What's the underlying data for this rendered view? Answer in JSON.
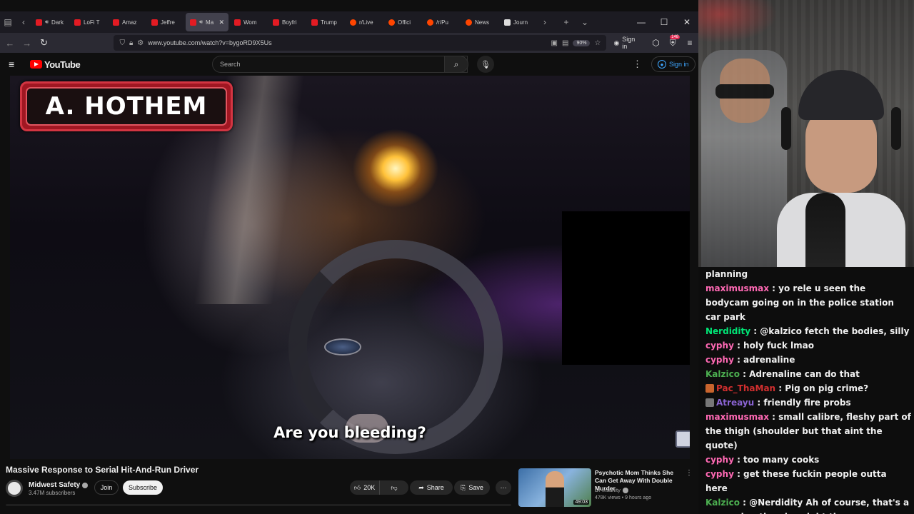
{
  "browser": {
    "tabs": [
      {
        "label": "Dark S",
        "favicon": "youtube",
        "audio": true
      },
      {
        "label": "LoFi T",
        "favicon": "youtube"
      },
      {
        "label": "Amaz",
        "favicon": "youtube"
      },
      {
        "label": "Jeffre",
        "favicon": "youtube"
      },
      {
        "label": "Ma",
        "favicon": "youtube",
        "audio": true,
        "active": true
      },
      {
        "label": "Wom",
        "favicon": "youtube"
      },
      {
        "label": "Boyfri",
        "favicon": "youtube"
      },
      {
        "label": "Trump",
        "favicon": "youtube"
      },
      {
        "label": "r/Live",
        "favicon": "reddit"
      },
      {
        "label": "Offici",
        "favicon": "reddit"
      },
      {
        "label": "/r/Pu",
        "favicon": "reddit"
      },
      {
        "label": "News",
        "favicon": "reddit"
      },
      {
        "label": "Journ",
        "favicon": "journal"
      }
    ],
    "url": "www.youtube.com/watch?v=bygoRD9X5Us",
    "zoom": "90%",
    "sign_in": "Sign in",
    "extension_badge": "148"
  },
  "youtube": {
    "logo_text": "YouTube",
    "search_placeholder": "Search",
    "sign_in": "Sign in"
  },
  "video": {
    "watermark": "A. HOTHEM",
    "subtitle": "Are you bleeding?",
    "title": "Massive Response to Serial Hit-And-Run Driver",
    "channel": "Midwest Safety",
    "subscribers": "3.47M subscribers",
    "join_label": "Join",
    "subscribe_label": "Subscribe",
    "likes": "20K",
    "share_label": "Share",
    "save_label": "Save"
  },
  "recommended": {
    "title": "Psychotic Mom Thinks She Can Get Away With Double Murder",
    "channel": "Dr Insanity",
    "meta": "478K views • 9 hours ago",
    "duration": "49:03"
  },
  "chat": [
    {
      "user": "",
      "text": "planning",
      "color": "#f0f0f0"
    },
    {
      "user": "maximusmax",
      "text": "yo rele u seen the bodycam going on in the police station car park",
      "color": "#ff69b4"
    },
    {
      "user": "Nerdidity",
      "text": "@kalzico fetch the bodies, silly",
      "color": "#00e676"
    },
    {
      "user": "cyphy",
      "text": "holy fuck lmao",
      "color": "#ff69b4"
    },
    {
      "user": "cyphy",
      "text": "adrenaline",
      "color": "#ff69b4"
    },
    {
      "user": "Kalzico",
      "text": "Adrenaline can do that",
      "color": "#4caf50"
    },
    {
      "user": "Pac_ThaMan",
      "text": "Pig on pig crime?",
      "color": "#d32f2f",
      "emote": "#c8642d"
    },
    {
      "user": "Atreayu",
      "text": "friendly fire probs",
      "color": "#8a63d2",
      "emote": "#777"
    },
    {
      "user": "maximusmax",
      "text": "small calibre, fleshy part of the thigh (shoulder but that aint the quote)",
      "color": "#ff69b4"
    },
    {
      "user": "cyphy",
      "text": "too many cooks",
      "color": "#ff69b4"
    },
    {
      "user": "cyphy",
      "text": "get these fuckin people outta here",
      "color": "#ff69b4"
    },
    {
      "user": "Kalzico",
      "text": "@Nerdidity Ah of course, that's a proper hunting dog right there",
      "color": "#4caf50"
    }
  ]
}
